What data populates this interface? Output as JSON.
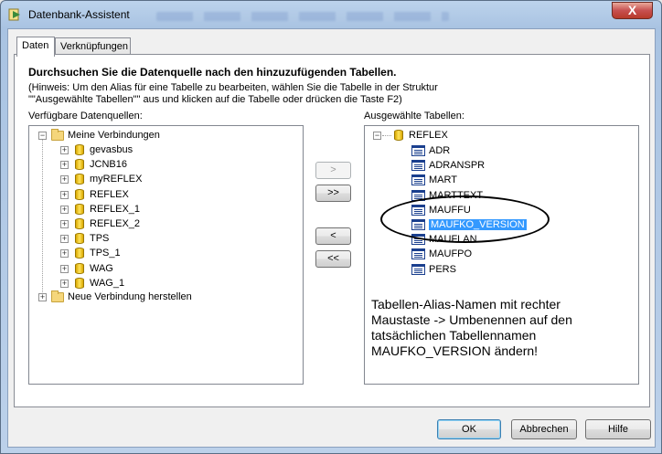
{
  "window": {
    "title": "Datenbank-Assistent",
    "close_label": "X"
  },
  "tabs": [
    {
      "label": "Daten"
    },
    {
      "label": "Verknüpfungen"
    }
  ],
  "heading": "Durchsuchen Sie die Datenquelle nach den hinzuzufügenden Tabellen.",
  "hint_line1": "(Hinweis: Um den Alias für eine Tabelle zu bearbeiten, wählen Sie die Tabelle in der Struktur",
  "hint_line2": "\"\"Ausgewählte Tabellen\"\" aus und klicken auf die Tabelle oder drücken die Taste F2)",
  "available": {
    "label": "Verfügbare Datenquellen:",
    "root": "Meine Verbindungen",
    "connections": [
      "gevasbus",
      "JCNB16",
      "myREFLEX",
      "REFLEX",
      "REFLEX_1",
      "REFLEX_2",
      "TPS",
      "TPS_1",
      "WAG",
      "WAG_1"
    ],
    "new_connection": "Neue Verbindung herstellen"
  },
  "selected": {
    "label": "Ausgewählte Tabellen:",
    "root": "REFLEX",
    "tables": [
      "ADR",
      "ADRANSPR",
      "MART",
      "MARTTEXT",
      "MAUFFU",
      "MAUFKO_VERSION",
      "MAUFLAN",
      "MAUFPO",
      "PERS"
    ],
    "selected_index": 5
  },
  "move_buttons": {
    "add_one": ">",
    "add_all": ">>",
    "remove_one": "<",
    "remove_all": "<<"
  },
  "annotation": {
    "line1": "Tabellen-Alias-Namen mit rechter",
    "line2": "Maustaste -> Umbenennen  auf den",
    "line3": "tatsächlichen Tabellennamen",
    "line4": "MAUFKO_VERSION ändern!"
  },
  "footer": {
    "ok": "OK",
    "cancel": "Abbrechen",
    "help": "Hilfe"
  }
}
